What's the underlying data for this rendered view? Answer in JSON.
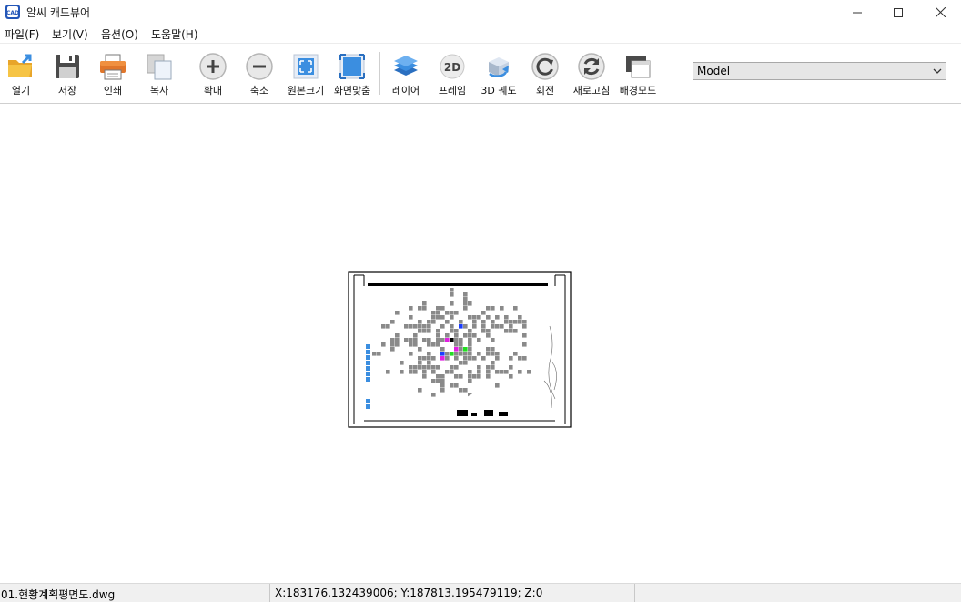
{
  "window": {
    "title": "알씨 캐드뷰어",
    "app_icon": "cad-icon",
    "controls": [
      "minimize-icon",
      "maximize-icon",
      "close-icon"
    ]
  },
  "menu": [
    {
      "label": "파일(F)"
    },
    {
      "label": "보기(V)"
    },
    {
      "label": "옵션(O)"
    },
    {
      "label": "도움말(H)"
    }
  ],
  "toolbar": {
    "items": [
      {
        "label": "열기",
        "icon": "open-folder-icon"
      },
      {
        "label": "저장",
        "icon": "save-disk-icon"
      },
      {
        "label": "인쇄",
        "icon": "printer-icon"
      },
      {
        "label": "복사",
        "icon": "copy-icon"
      },
      {
        "label": "확대",
        "icon": "zoom-in-icon"
      },
      {
        "label": "축소",
        "icon": "zoom-out-icon"
      },
      {
        "label": "원본크기",
        "icon": "actual-size-icon"
      },
      {
        "label": "화면맞춤",
        "icon": "fit-screen-icon"
      },
      {
        "label": "레이어",
        "icon": "layers-icon"
      },
      {
        "label": "프레임",
        "icon": "frame-2d-icon"
      },
      {
        "label": "3D 궤도",
        "icon": "orbit-3d-icon"
      },
      {
        "label": "회전",
        "icon": "rotate-icon"
      },
      {
        "label": "새로고침",
        "icon": "refresh-icon"
      },
      {
        "label": "배경모드",
        "icon": "background-mode-icon"
      }
    ],
    "layout_select": {
      "value": "Model"
    }
  },
  "status": {
    "filename": "01.현황계획평면도.dwg",
    "coordinates": "X:183176.132439006; Y:187813.195479119; Z:0"
  },
  "colors": {
    "accent_blue": "#3b8ee0",
    "drawing_gray": "#8a8a8a",
    "layer_magenta": "#e020e0",
    "layer_green": "#22dd22",
    "layer_blue": "#1a3cff",
    "status_bar_bg": "#f0f0f0"
  }
}
